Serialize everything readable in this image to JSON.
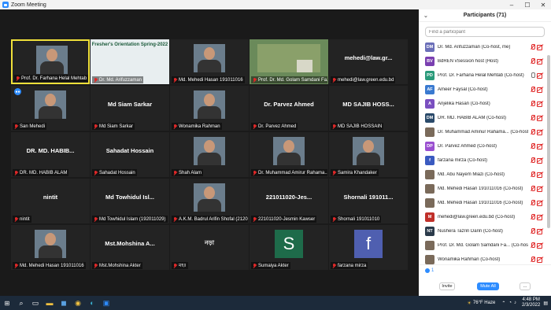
{
  "window": {
    "title": "Zoom Meeting"
  },
  "tiles": [
    {
      "name": "",
      "label": "Prof. Dr. Farhana Helal Mehtab",
      "kind": "photo",
      "active": true
    },
    {
      "name": "",
      "label": "Dr. Md. Arifuzzaman",
      "kind": "slide",
      "slide_title": "Fresher's Orientation Spring-2022"
    },
    {
      "name": "",
      "label": "Md. Mehedi Hasan 191011016",
      "kind": "photo"
    },
    {
      "name": "",
      "label": "Prof. Dr. Md. Golam Samdani Fa...",
      "kind": "campus"
    },
    {
      "name": "mehedi@law.gr...",
      "label": "mehedi@law.green.edu.bd",
      "kind": "text"
    },
    {
      "name": "",
      "label": "San Mehedi",
      "kind": "photo"
    },
    {
      "name": "Md Siam Sarkar",
      "label": "Md Siam Sarkar",
      "kind": "text"
    },
    {
      "name": "",
      "label": "Wonamika Rahman",
      "kind": "photo"
    },
    {
      "name": "Dr. Parvez Ahmed",
      "label": "Dr. Parvez Ahmed",
      "kind": "text"
    },
    {
      "name": "MD SAJIB HOSS...",
      "label": "MD SAJIB HOSSAIN",
      "kind": "text"
    },
    {
      "name": "DR. MD. HABIB...",
      "label": "DR. MD. HABIB ALAM",
      "kind": "text"
    },
    {
      "name": "Sahadat Hossain",
      "label": "Sahadat Hossain",
      "kind": "text"
    },
    {
      "name": "",
      "label": "Shah Alam",
      "kind": "photo"
    },
    {
      "name": "",
      "label": "Dr. Muhammad Amirur Rahama...",
      "kind": "photo"
    },
    {
      "name": "",
      "label": "Samira Khandaker",
      "kind": "photo"
    },
    {
      "name": "nintit",
      "label": "nintit",
      "kind": "text"
    },
    {
      "name": "Md Towhidul Isl...",
      "label": "Md Towhidul Islam (192011029)",
      "kind": "text"
    },
    {
      "name": "",
      "label": "A.K.M. Badrul Arifin Shofal (2120...",
      "kind": "photo"
    },
    {
      "name": "221011020-Jes...",
      "label": "221011020-Jesmin Kawser",
      "kind": "text"
    },
    {
      "name": "Shornali 191011...",
      "label": "Shornali 191011010",
      "kind": "text"
    },
    {
      "name": "",
      "label": "Md. Mehedi Hasan 191011016",
      "kind": "photo"
    },
    {
      "name": "Mst.Mohshina A...",
      "label": "Mst.Mohshina Akter",
      "kind": "text"
    },
    {
      "name": "নড়া",
      "label": "মহঃ",
      "kind": "text"
    },
    {
      "name": "S",
      "label": "Sumaiya Akter",
      "kind": "avatar",
      "color": "#1e6b4a"
    },
    {
      "name": "f",
      "label": "farzana mirza",
      "kind": "avatar",
      "color": "#4f5fb0"
    }
  ],
  "panel": {
    "title": "Participants (71)",
    "search_placeholder": "Find a participant",
    "participants": [
      {
        "initials": "DM",
        "color": "#6b6fb8",
        "name": "Dr. Md. Arifuzzaman (Co-host, me)",
        "mic": "muted",
        "cam": "off"
      },
      {
        "initials": "BV",
        "color": "#7a3fb0",
        "name": "BdREN vSession host (Host)",
        "mic": "muted",
        "cam": "off"
      },
      {
        "initials": "PD",
        "color": "#2a9a7a",
        "name": "Prof. Dr. Farhana Helal Mehtab (Co-host)",
        "mic": "on",
        "cam": "off"
      },
      {
        "initials": "AF",
        "color": "#3a7ad0",
        "name": "Ameer Faysal (Co-host)",
        "mic": "muted",
        "cam": "off"
      },
      {
        "initials": "A",
        "color": "#7a4fc0",
        "name": "Anjelika Hasan (Co-host)",
        "mic": "muted",
        "cam": "off"
      },
      {
        "initials": "DM",
        "color": "#2a4a6a",
        "name": "DR. MD. HABIB ALAM (Co-host)",
        "mic": "muted",
        "cam": "off"
      },
      {
        "initials": "",
        "color": "#7a6a5a",
        "name": "Dr. Muhammad Aminur Rahama... (Co-host)",
        "mic": "muted",
        "cam": "off"
      },
      {
        "initials": "DP",
        "color": "#9a4fd0",
        "name": "Dr. Parvez Ahmed (Co-host)",
        "mic": "muted",
        "cam": "off"
      },
      {
        "initials": "f",
        "color": "#3a5ac0",
        "name": "farzana mirza (Co-host)",
        "mic": "muted",
        "cam": "off"
      },
      {
        "initials": "",
        "color": "#7a6a5a",
        "name": "Md. Abu Nayem Miazi (Co-host)",
        "mic": "muted",
        "cam": "off"
      },
      {
        "initials": "",
        "color": "#7a6a5a",
        "name": "Md. Mehedi Hasan 191011016 (Co-host)",
        "mic": "muted",
        "cam": "off"
      },
      {
        "initials": "",
        "color": "#7a6a5a",
        "name": "Md. Mehedi Hasan 191011016 (Co-host)",
        "mic": "muted",
        "cam": "off"
      },
      {
        "initials": "M",
        "color": "#c0302a",
        "name": "mehedi@law.green.edu.bd (Co-host)",
        "mic": "muted",
        "cam": "off"
      },
      {
        "initials": "NT",
        "color": "#2a3a4a",
        "name": "Nushera Tazrin Darin (Co-host)",
        "mic": "muted",
        "cam": "off"
      },
      {
        "initials": "",
        "color": "#7a6a5a",
        "name": "Prof. Dr. Md. Golam Samdani Fa... (Co-host)",
        "mic": "muted",
        "cam": "off"
      },
      {
        "initials": "",
        "color": "#7a6a5a",
        "name": "Wonamika Rahman (Co-host)",
        "mic": "muted",
        "cam": "off"
      }
    ],
    "status_count": "1",
    "invite_label": "Invite",
    "mute_all_label": "Mute All",
    "more_label": "..."
  },
  "taskbar": {
    "weather": "76°F  Haze",
    "time": "4:48 PM",
    "date": "2/3/2022"
  }
}
